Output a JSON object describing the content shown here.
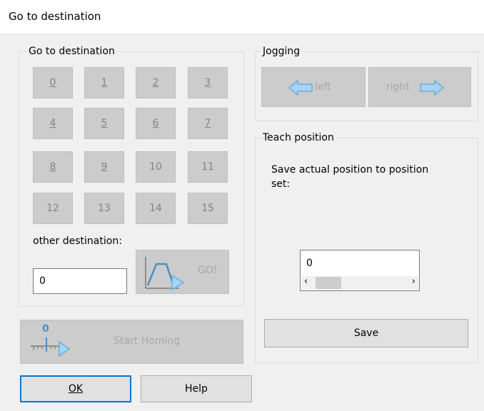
{
  "window": {
    "title": "Go to destination"
  },
  "destination_group": {
    "title": "Go to destination",
    "buttons": [
      "0",
      "1",
      "2",
      "3",
      "4",
      "5",
      "6",
      "7",
      "8",
      "9",
      "10",
      "11",
      "12",
      "13",
      "14",
      "15"
    ],
    "other_label": "other destination:",
    "other_value": "0",
    "go_label": "GO!"
  },
  "jogging": {
    "title": "Jogging",
    "left_label": "left",
    "right_label": "right"
  },
  "teach": {
    "title": "Teach position",
    "description": "Save actual position to position set:",
    "value": "0",
    "save_label": "Save"
  },
  "homing": {
    "label": "Start Homing",
    "indicator": "0"
  },
  "footer": {
    "ok_label": "OK",
    "help_label": "Help"
  },
  "colors": {
    "accent": "#0078d7",
    "arrow_fill": "#a9d3f2",
    "arrow_stroke": "#6baed6"
  }
}
